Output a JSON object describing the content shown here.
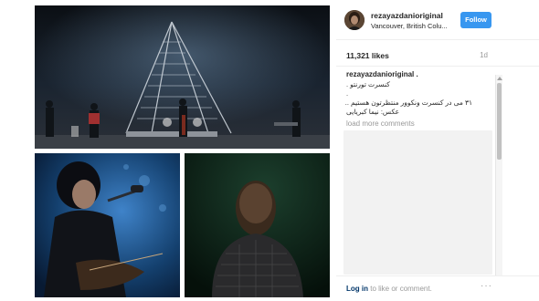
{
  "post": {
    "username": "rezayazdanioriginal",
    "location": "Vancouver, British Colu...",
    "follow_label": "Follow",
    "likes": "11,321 likes",
    "time": "1d",
    "caption_user": "rezayazdanioriginal .",
    "caption_lines": [
      "کنسرت تورنتو .",
      ".",
      "۳۱ می در کنسرت ونکوور منتظرتون هستیم ..",
      "عکس: نیما کبریایی"
    ],
    "load_more": "load more comments",
    "login_link": "Log in",
    "login_rest": "to like or comment.",
    "more_icon": "···"
  },
  "photos": {
    "stage": "concert-stage-photo",
    "singer": "singer-with-guitar-photo",
    "back": "singer-back-view-photo"
  },
  "colors": {
    "follow_button": "#3897f0",
    "link": "#003569",
    "muted": "#999999"
  }
}
